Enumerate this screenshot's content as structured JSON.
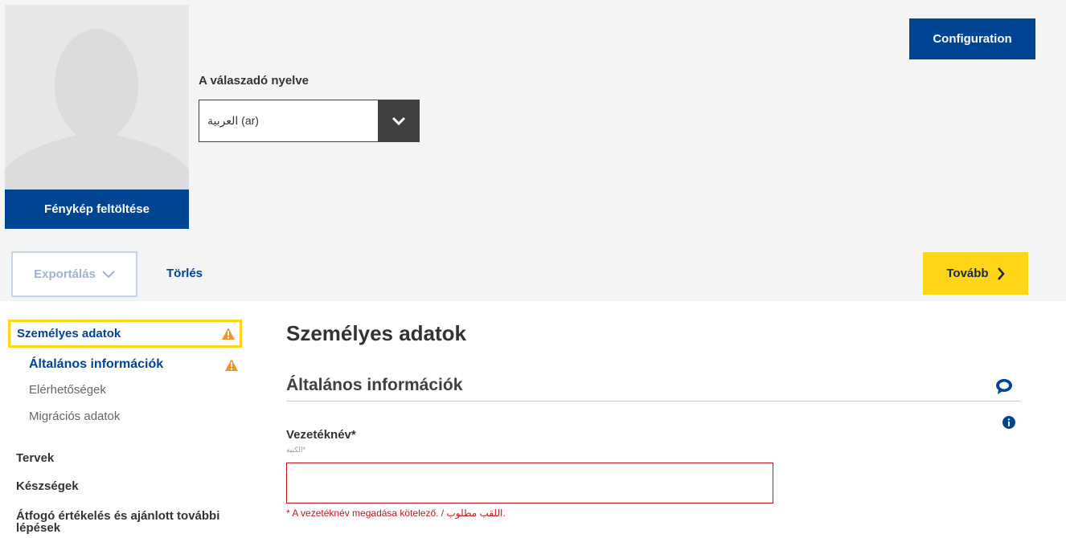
{
  "photo": {
    "upload_label": "Fénykép feltöltése"
  },
  "language": {
    "label": "A válaszadó nyelve",
    "selected": "العربية (ar)"
  },
  "header": {
    "config_label": "Configuration"
  },
  "toolbar": {
    "export_label": "Exportálás",
    "delete_label": "Törlés",
    "next_label": "Tovább"
  },
  "sidebar": {
    "active": {
      "label": "Személyes adatok"
    },
    "sub_active": {
      "label": "Általános információk"
    },
    "sub_items": [
      {
        "label": "Elérhetőségek"
      },
      {
        "label": "Migrációs adatok"
      }
    ],
    "main_items": [
      {
        "label": "Tervek"
      },
      {
        "label": "Készségek"
      },
      {
        "label": "Átfogó értékelés és ajánlott további lépések"
      }
    ]
  },
  "main": {
    "title": "Személyes adatok",
    "section_title": "Általános információk",
    "field": {
      "label": "Vezetéknév*",
      "sublabel": "*الكنية",
      "value": "",
      "error": "* A vezetéknév megadása kötelező. / اللقب مطلوب."
    }
  },
  "colors": {
    "primary": "#004494",
    "accent": "#ffd617",
    "error": "#c4161c",
    "warning": "#f29527"
  },
  "icons": {
    "warning": "warning-triangle-icon",
    "comment": "comment-bubble-icon",
    "info": "info-circle-icon",
    "chevron_down": "chevron-down-icon",
    "chevron_right": "chevron-right-icon",
    "avatar": "avatar-silhouette-icon"
  }
}
